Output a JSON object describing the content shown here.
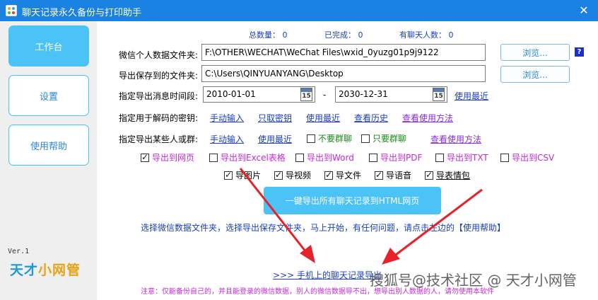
{
  "window": {
    "title": "聊天记录永久备份与打印助手",
    "close": "✕"
  },
  "sidebar": {
    "items": [
      {
        "label": "工作台",
        "active": true
      },
      {
        "label": "设置",
        "active": false
      },
      {
        "label": "使用帮助",
        "active": false
      }
    ],
    "version": "Ver.1",
    "brand_part1": "天才",
    "brand_part2": "小网管"
  },
  "stats": {
    "total_label": "总数量： 0",
    "done_label": "已完成： 0",
    "people_label": "有聊天人数： 0"
  },
  "form": {
    "wechat_dir_label": "微信个人数据文件夹:",
    "wechat_dir_value": "F:\\OTHER\\WECHAT\\WeChat Files\\wxid_0yuzg01p9j9122",
    "save_dir_label": "导出保存到的文件夹:",
    "save_dir_value": "C:\\Users\\QINYUANYANG\\Desktop",
    "browse_label": "浏览...",
    "help_q": "?",
    "range_label": "指定导出消息时间段:",
    "date_from": "2010-01-01",
    "date_to": "2030-12-31",
    "cal_num": "15",
    "dash": "-",
    "use_recent": "使用最近",
    "key_label": "指定用于解码的密钥:",
    "key_links": [
      "手动输入",
      "只取密钥",
      "使用最近",
      "查看历史"
    ],
    "key_howto": "查看使用方法",
    "who_label": "指定导出某些人或群:",
    "who_links": [
      "手动输入",
      "使用最近"
    ],
    "no_group": "不要群聊",
    "only_group": "只要群聊",
    "who_howto": "查看使用方法"
  },
  "export_targets": [
    {
      "label": "导出到网页",
      "checked": true
    },
    {
      "label": "导出到Excel表格",
      "checked": false
    },
    {
      "label": "导出到Word",
      "checked": false
    },
    {
      "label": "导出到PDF",
      "checked": false
    },
    {
      "label": "导出到TXT",
      "checked": false
    },
    {
      "label": "导出到CSV",
      "checked": false
    }
  ],
  "media_options": [
    {
      "label": "导图片",
      "checked": true
    },
    {
      "label": "导视频",
      "checked": true
    },
    {
      "label": "导文件",
      "checked": true
    },
    {
      "label": "导语音",
      "checked": true
    },
    {
      "label": "导表情包",
      "checked": true
    }
  ],
  "main_button": "一键导出所有聊天记录到HTML网页",
  "hint": "选择微信数据文件夹，选择导出保存文件夹，马上开始，有任何问题，请点击左边的【使用帮助】",
  "bottom_link": ">>>  手机上的聊天记录导出",
  "notice": "注意：仅能备份自己的，并且能登录的微信数据，别人的微信数据导不出，想导出别人数据的人，请勿使用本软件",
  "watermark": "搜狐号@技术社区 @ 天才小网管",
  "colors": {
    "accent": "#1a82e2",
    "button": "#4cc3f7",
    "link": "#1a3fbf",
    "purple_link": "#8a2be2",
    "notice": "#c42bd6",
    "arrow": "#e8202a"
  }
}
